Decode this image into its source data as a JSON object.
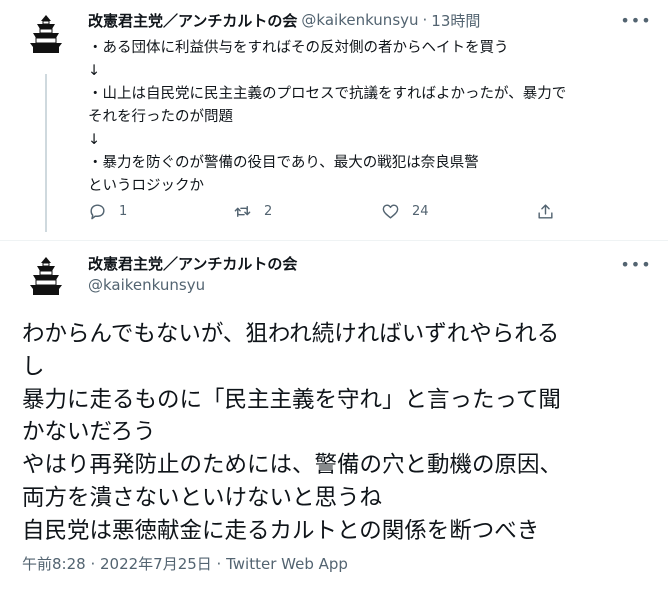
{
  "tweet1": {
    "name": "改憲君主党／アンチカルトの会",
    "handle": "@kaikenkunsyu",
    "separator": "·",
    "time": "13時間",
    "lines": [
      "・ある団体に利益供与をすればその反対側の者からヘイトを買う",
      "↓",
      "・山上は自民党に民主主義のプロセスで抗議をすればよかったが、暴力で",
      "それを行ったのが問題",
      "↓",
      "・暴力を防ぐのが警備の役目であり、最大の戦犯は奈良県警",
      "というロジックか"
    ],
    "reply_count": "1",
    "retweet_count": "2",
    "like_count": "24",
    "more_icon": "more-dots-icon"
  },
  "tweet2": {
    "name": "改憲君主党／アンチカルトの会",
    "handle": "@kaikenkunsyu",
    "lines": [
      "わからんでもないが、狙われ続ければいずれやられる",
      "し",
      "暴力に走るものに「民主主義を守れ」と言ったって聞",
      "かないだろう",
      "やはり再発防止のためには、警備の穴と動機の原因、",
      "両方を潰さないといけないと思うね",
      "自民党は悪徳献金に走るカルトとの関係を断つべき"
    ],
    "timestamp": "午前8:28 · 2022年7月25日 · Twitter Web App",
    "more_icon": "more-dots-icon"
  },
  "colors": {
    "text": "#0f1419",
    "secondary": "#536471",
    "thread_line": "#cfd9de",
    "divider": "#eff3f4"
  }
}
